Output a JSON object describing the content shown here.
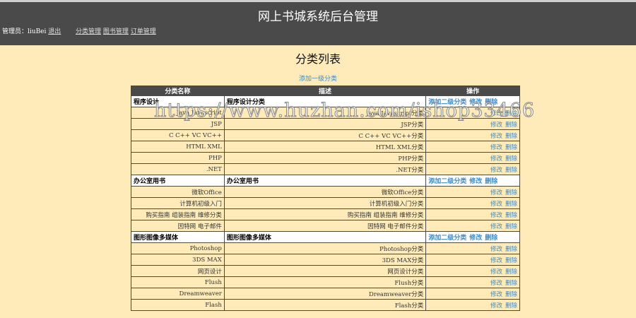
{
  "header": {
    "title": "网上书城系统后台管理",
    "admin_label": "管理员：",
    "admin_name": "liuBei",
    "logout": "退出",
    "nav": [
      "分类管理",
      "图书管理",
      "订单管理"
    ]
  },
  "page": {
    "title": "分类列表",
    "add_top": "添加一级分类"
  },
  "table": {
    "headers": [
      "分类名称",
      "描述",
      "操作"
    ],
    "add_sub": "添加二级分类",
    "edit": "修改",
    "delete": "删除",
    "groups": [
      {
        "name": "程序设计",
        "desc": "程序设计分类",
        "children": [
          {
            "name": "Java Javascript",
            "desc": "Java Javascript分类"
          },
          {
            "name": "JSP",
            "desc": "JSP分类"
          },
          {
            "name": "C C++ VC VC++",
            "desc": "C C++ VC VC++分类"
          },
          {
            "name": "HTML XML",
            "desc": "HTML XML分类"
          },
          {
            "name": "PHP",
            "desc": "PHP分类"
          },
          {
            "name": ".NET",
            "desc": ".NET分类"
          }
        ]
      },
      {
        "name": "办公室用书",
        "desc": "办公室用书",
        "children": [
          {
            "name": "微软Office",
            "desc": "微软Office分类"
          },
          {
            "name": "计算机初级入门",
            "desc": "计算机初级入门分类"
          },
          {
            "name": "购买指南 组装指南 维修分类",
            "desc": "购买指南 组装指南 维修分类"
          },
          {
            "name": "因特网 电子邮件",
            "desc": "因特网 电子邮件分类"
          }
        ]
      },
      {
        "name": "图形图像多媒体",
        "desc": "图形图像多媒体",
        "children": [
          {
            "name": "Photoshop",
            "desc": "Photoshop分类"
          },
          {
            "name": "3DS MAX",
            "desc": "3DS MAX分类"
          },
          {
            "name": "网页设计",
            "desc": "网页设计分类"
          },
          {
            "name": "Flush",
            "desc": "Flush分类"
          },
          {
            "name": "Dreamweaver",
            "desc": "Dreamweaver分类"
          },
          {
            "name": "Flash",
            "desc": "Flash分类"
          }
        ]
      }
    ]
  },
  "watermark": "https://www.huzhan.com/ishop33466"
}
